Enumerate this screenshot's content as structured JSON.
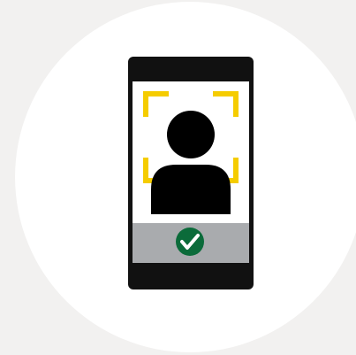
{
  "illustration": {
    "subject": "face-verification-success",
    "icons": [
      "phone-icon",
      "face-scan-frame-icon",
      "person-silhouette-icon",
      "checkmark-circle-icon"
    ]
  },
  "colors": {
    "page_background": "#f2f1f0",
    "circle_background": "#ffffff",
    "phone_body": "#111111",
    "screen_background": "#ffffff",
    "scan_frame": "#f5cc00",
    "person_silhouette": "#000000",
    "status_bar": "#a9abae",
    "check_circle": "#0b6b3a",
    "check_mark": "#ffffff"
  }
}
